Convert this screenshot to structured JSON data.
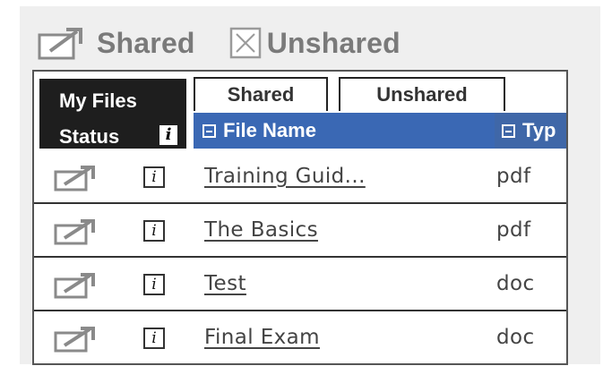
{
  "legend": {
    "shared_label": "Shared",
    "unshared_label": "Unshared",
    "shared_icon": "shared-icon",
    "unshared_icon": "unshared-icon"
  },
  "header": {
    "my_files_label": "My Files",
    "status_label": "Status",
    "status_info_glyph": "i"
  },
  "tabs": [
    {
      "label": "Shared"
    },
    {
      "label": "Unshared"
    }
  ],
  "columns": {
    "file_name": "File Name",
    "type": "Typ"
  },
  "rows": [
    {
      "status_icon": "shared-icon",
      "info_glyph": "i",
      "file_name": "Training Guid...",
      "type": "pdf"
    },
    {
      "status_icon": "shared-icon",
      "info_glyph": "i",
      "file_name": "The Basics",
      "type": "pdf"
    },
    {
      "status_icon": "shared-icon",
      "info_glyph": "i",
      "file_name": "Test",
      "type": "doc"
    },
    {
      "status_icon": "shared-icon",
      "info_glyph": "i",
      "file_name": "Final Exam",
      "type": "doc"
    }
  ],
  "colors": {
    "header_dark": "#1e1e1e",
    "column_header_blue": "#3a68b4",
    "panel_bg": "#efefef",
    "legend_text": "#7a7a7a"
  }
}
